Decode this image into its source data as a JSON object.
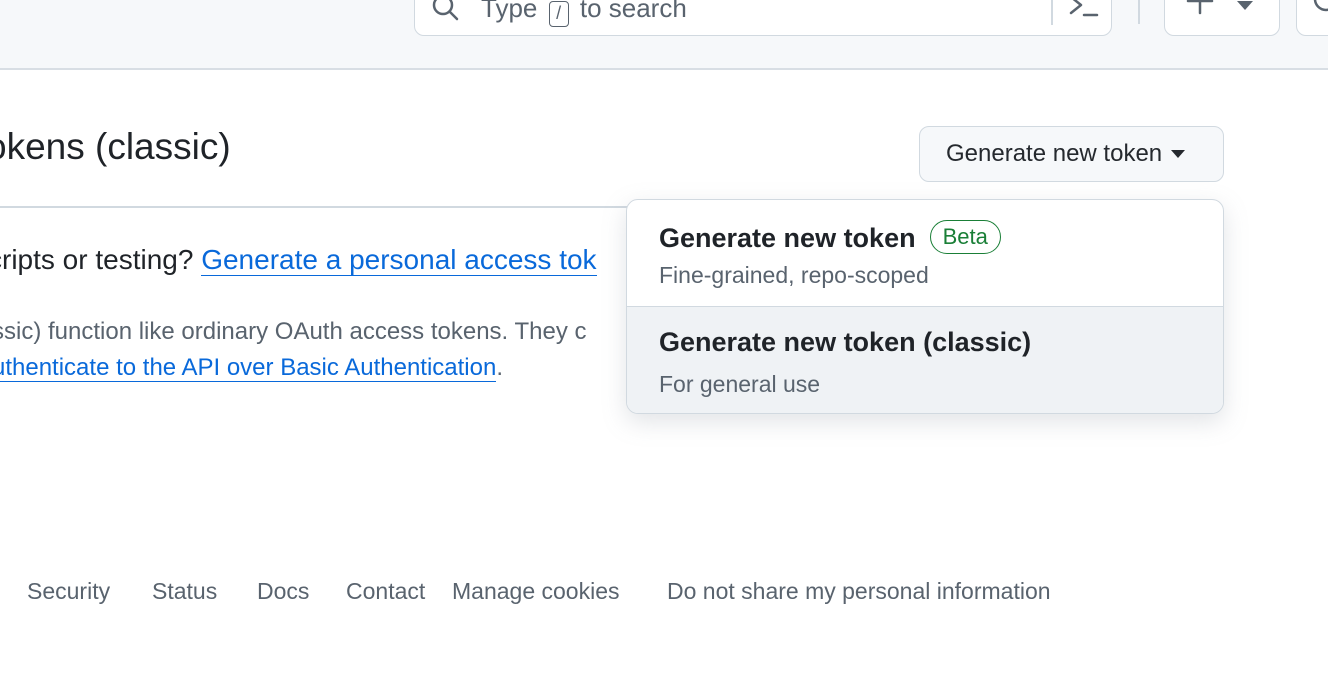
{
  "header": {
    "search": {
      "before": "Type",
      "key": "/",
      "after": "to search"
    },
    "icons": {
      "search": "search-icon",
      "terminal": "terminal-icon",
      "plus": "plus-icon",
      "caret": "triangle-down-icon",
      "issues": "issue-icon"
    }
  },
  "page": {
    "title": "okens (classic)",
    "generate_button": "Generate new token",
    "line1_lead": "cripts or testing?",
    "line1_link": "Generate a personal access tok",
    "line2": "ssic) function like ordinary OAuth access tokens. They c",
    "line3_link": "uthenticate to the API over Basic Authentication",
    "line3_end": "."
  },
  "menu": {
    "items": [
      {
        "title": "Generate new token",
        "badge": "Beta",
        "description": "Fine-grained, repo-scoped"
      },
      {
        "title": "Generate new token (classic)",
        "description": "For general use"
      }
    ]
  },
  "footer": {
    "links": [
      "Security",
      "Status",
      "Docs",
      "Contact",
      "Manage cookies",
      "Do not share my personal information"
    ]
  },
  "colors": {
    "link": "#0969da",
    "beta_badge": "#1a7f37",
    "header_bg": "#f6f8fa",
    "menu_hover": "#eff2f5"
  }
}
